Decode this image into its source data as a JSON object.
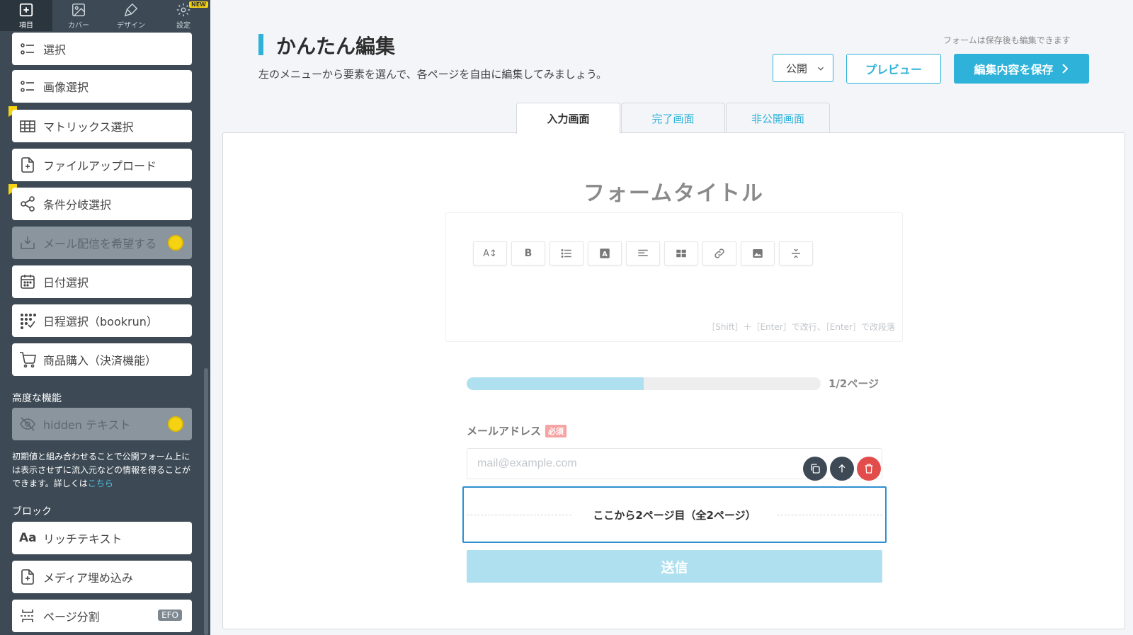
{
  "sidebar": {
    "tabs": [
      {
        "label": "項目",
        "icon": "add-square-icon"
      },
      {
        "label": "カバー",
        "icon": "image-icon"
      },
      {
        "label": "デザイン",
        "icon": "brush-icon"
      },
      {
        "label": "設定",
        "icon": "gear-icon",
        "badge": "NEW"
      }
    ],
    "items": [
      {
        "label": "選択",
        "icon": "list-icon"
      },
      {
        "label": "画像選択",
        "icon": "list-icon"
      },
      {
        "label": "マトリックス選択",
        "icon": "table-icon"
      },
      {
        "label": "ファイルアップロード",
        "icon": "file-plus-icon"
      },
      {
        "label": "条件分岐選択",
        "icon": "share-icon"
      },
      {
        "label": "メール配信を希望する",
        "icon": "inbox-icon",
        "locked": true
      },
      {
        "label": "日付選択",
        "icon": "calendar-icon"
      },
      {
        "label": "日程選択（bookrun）",
        "icon": "dots-check-icon"
      },
      {
        "label": "商品購入（決済機能）",
        "icon": "cart-icon"
      }
    ],
    "advanced_heading": "高度な機能",
    "hidden_text_item": {
      "label": "hidden テキスト",
      "icon": "eye-off-icon",
      "locked": true
    },
    "hidden_note": "初期値と組み合わせることで公開フォーム上には表示させずに流入元などの情報を得ることができます。詳しくは",
    "hidden_note_link": "こちら",
    "block_heading": "ブロック",
    "block_items": [
      {
        "label": "リッチテキスト",
        "icon": "text-aa-icon"
      },
      {
        "label": "メディア埋め込み",
        "icon": "file-plus-icon"
      },
      {
        "label": "ページ分割",
        "icon": "page-split-icon",
        "badge": "EFO"
      }
    ]
  },
  "header": {
    "title": "かんたん編集",
    "subtitle": "左のメニューから要素を選んで、各ページを自由に編集してみましょう。",
    "save_note": "フォームは保存後も編集できます",
    "visibility": "公開",
    "preview_label": "プレビュー",
    "save_label": "編集内容を保存"
  },
  "tabs": [
    {
      "label": "入力画面",
      "active": true
    },
    {
      "label": "完了画面",
      "active": false
    },
    {
      "label": "非公開画面",
      "active": false
    }
  ],
  "form": {
    "title": "フォームタイトル",
    "editor_hint": "［Shift］＋［Enter］で改行、［Enter］で改段落",
    "progress_fraction": 0.5,
    "progress_label": "1/2ページ",
    "email_label": "メールアドレス",
    "required_label": "必須",
    "email_placeholder": "mail@example.com",
    "page_break_label": "ここから2ページ目（全2ページ）",
    "submit_label": "送信"
  },
  "colors": {
    "accent": "#2fb2d9",
    "sidebar_bg": "#3d4a55",
    "danger": "#e24c4b",
    "progress_fill": "#aee0ef"
  }
}
